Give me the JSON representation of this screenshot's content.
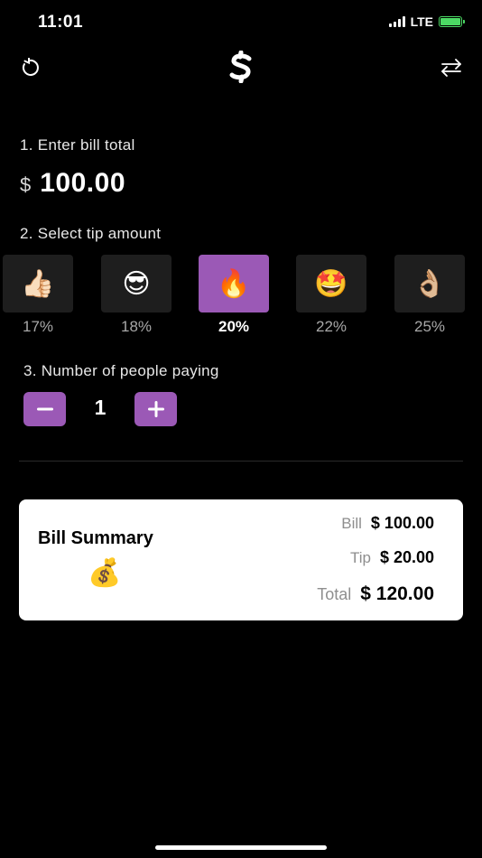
{
  "status_bar": {
    "time": "11:01",
    "network": "LTE",
    "battery_color": "#4cd964"
  },
  "nav": {
    "left_icon": "reset-icon",
    "center_icon": "dollar-logo-icon",
    "right_icon": "swap-arrows-icon"
  },
  "bill": {
    "label": "1. Enter bill total",
    "currency": "$",
    "value": "100.00"
  },
  "tip": {
    "label": "2. Select tip amount",
    "selected_index": 2,
    "options": [
      {
        "emoji": "👍🏻",
        "percent": "17%"
      },
      {
        "emoji": "😎",
        "percent": "18%"
      },
      {
        "emoji": "🔥",
        "percent": "20%"
      },
      {
        "emoji": "🤩",
        "percent": "22%"
      },
      {
        "emoji": "👌🏼",
        "percent": "25%"
      }
    ]
  },
  "people": {
    "label": "3. Number of people paying",
    "count": "1",
    "decrement_icon": "minus-icon",
    "increment_icon": "plus-icon"
  },
  "summary": {
    "title": "Bill Summary",
    "emoji": "💰",
    "bill_label": "Bill",
    "bill_value": "$ 100.00",
    "tip_label": "Tip",
    "tip_value": "$ 20.00",
    "total_label": "Total",
    "total_value": "$ 120.00"
  },
  "colors": {
    "accent": "#9b59b6",
    "background": "#000000",
    "tile": "#1e1e1e",
    "card": "#ffffff"
  }
}
